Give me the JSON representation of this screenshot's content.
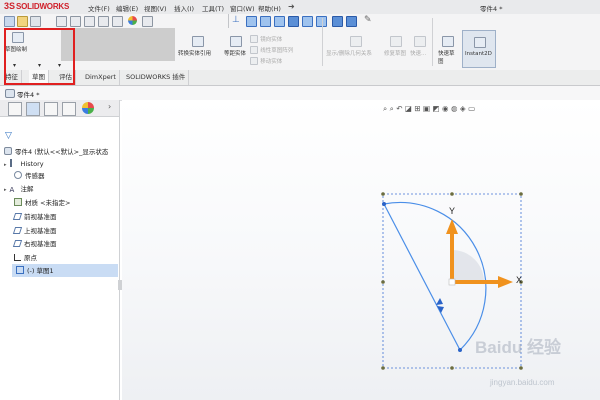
{
  "app": {
    "logo_ds": "3S",
    "logo_name": "SOLIDWORKS",
    "doc_title": "零件4 *"
  },
  "menu": [
    "文件(F)",
    "编辑(E)",
    "视图(V)",
    "插入(I)",
    "工具(T)",
    "窗口(W)",
    "帮助(H)"
  ],
  "toolbar": {
    "sketch": "草图绘制",
    "convert_entities": "转换实体引用",
    "offset_entities": "等距实体",
    "mirror_entities": "镜向实体",
    "linear_pattern": "线性草图阵列",
    "move_entities": "移动实体",
    "display_delete_relations": "显示/删除几何关系",
    "repair_sketch": "修复草图",
    "quick_snaps": "快速...",
    "rapid_sketch": "快速草图",
    "instant2d": "Instant2D"
  },
  "tabs": [
    "特征",
    "草图",
    "评估",
    "DimXpert",
    "SOLIDWORKS 插件"
  ],
  "breadcrumb": "零件4 *",
  "feature_tree": {
    "root": "零件4 (默认<<默认>_显示状态",
    "items": [
      "History",
      "传感器",
      "注解",
      "材质 <未指定>",
      "前视基准面",
      "上视基准面",
      "右视基准面",
      "原点",
      "(-) 草图1"
    ]
  },
  "triad": {
    "x_label": "X",
    "y_label": "Y"
  },
  "watermark": {
    "brand": "Baidu 经验",
    "url": "jingyan.baidu.com"
  },
  "colors": {
    "sketch_blue": "#4a8ee8",
    "axis_orange": "#f0921e",
    "highlight_red": "#e02020"
  }
}
